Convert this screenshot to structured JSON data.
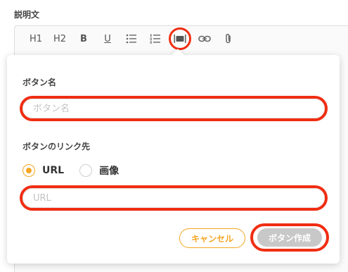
{
  "description_label": "説明文",
  "toolbar": {
    "h1": "H1",
    "h2": "H2",
    "bold": "B",
    "underline": "U",
    "icons": [
      "bullet-list-icon",
      "numbered-list-icon",
      "button-insert-icon",
      "link-icon",
      "attachment-icon"
    ]
  },
  "dialog": {
    "button_name_label": "ボタン名",
    "button_name_placeholder": "ボタン名",
    "button_link_label": "ボタンのリンク先",
    "radio_options": [
      {
        "label": "URL",
        "selected": true
      },
      {
        "label": "画像",
        "selected": false
      }
    ],
    "url_placeholder": "URL",
    "cancel_label": "キャンセル",
    "create_label": "ボタン作成"
  },
  "colors": {
    "accent": "#f5a623",
    "highlight": "#f02d12",
    "disabled_button": "#c8c8c8"
  }
}
